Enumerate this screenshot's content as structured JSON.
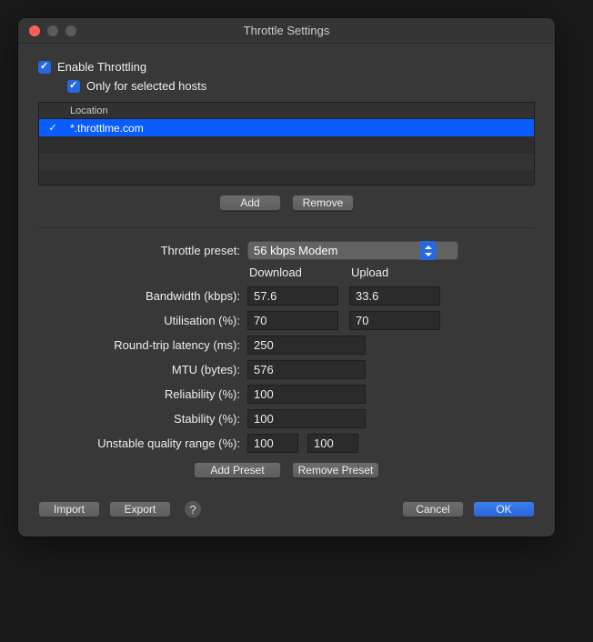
{
  "window": {
    "title": "Throttle Settings"
  },
  "checkboxes": {
    "enable_label": "Enable Throttling",
    "enable_checked": true,
    "selected_hosts_label": "Only for selected hosts",
    "selected_hosts_checked": true
  },
  "table": {
    "header_location": "Location",
    "rows": [
      {
        "checked": true,
        "location": "*.throttlme.com",
        "selected": true
      }
    ]
  },
  "table_buttons": {
    "add": "Add",
    "remove": "Remove"
  },
  "form": {
    "preset_label": "Throttle preset:",
    "preset_value": "56 kbps Modem",
    "col_download": "Download",
    "col_upload": "Upload",
    "bandwidth_label": "Bandwidth (kbps):",
    "bandwidth_dl": "57.6",
    "bandwidth_ul": "33.6",
    "utilisation_label": "Utilisation (%):",
    "utilisation_dl": "70",
    "utilisation_ul": "70",
    "latency_label": "Round-trip latency (ms):",
    "latency": "250",
    "mtu_label": "MTU (bytes):",
    "mtu": "576",
    "reliability_label": "Reliability (%):",
    "reliability": "100",
    "stability_label": "Stability (%):",
    "stability": "100",
    "unstable_label": "Unstable quality range (%):",
    "unstable_lo": "100",
    "unstable_hi": "100"
  },
  "preset_buttons": {
    "add": "Add Preset",
    "remove": "Remove Preset"
  },
  "footer": {
    "import": "Import",
    "export": "Export",
    "help": "?",
    "cancel": "Cancel",
    "ok": "OK"
  }
}
